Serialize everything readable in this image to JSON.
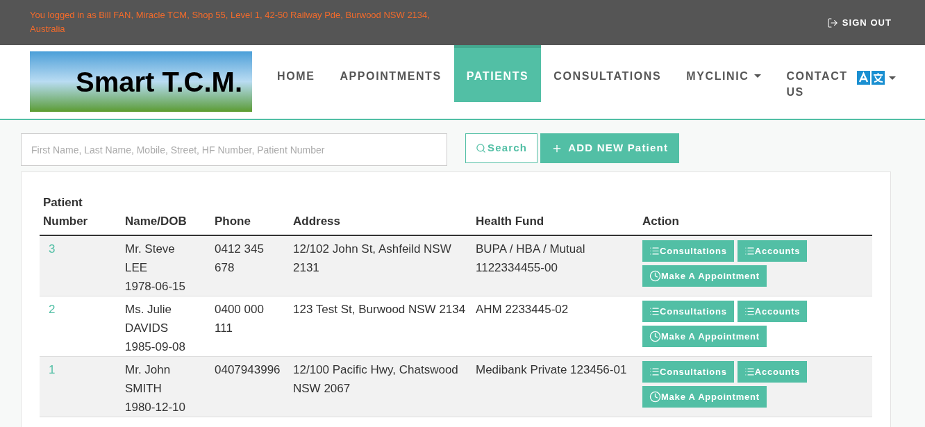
{
  "top_bar": {
    "login_text": "You logged in as Bill FAN, Miracle TCM, Shop 55, Level 1, 42-50 Railway Pde, Burwood NSW 2134, Australia",
    "sign_out": "SIGN OUT"
  },
  "logo": {
    "text": "Smart T.C.M."
  },
  "nav": [
    {
      "label": "HOME",
      "selected": false,
      "dropdown": false
    },
    {
      "label": "APPOINTMENTS",
      "selected": false,
      "dropdown": false
    },
    {
      "label": "PATIENTS",
      "selected": true,
      "dropdown": false
    },
    {
      "label": "CONSULTATIONS",
      "selected": false,
      "dropdown": false
    },
    {
      "label": "MYCLINIC",
      "selected": false,
      "dropdown": true
    },
    {
      "label": "CONTACT US",
      "selected": false,
      "dropdown": false
    }
  ],
  "search": {
    "placeholder": "First Name, Last Name, Mobile, Street, HF Number, Patient Number",
    "search_button": "Search",
    "add_button": "ADD NEW Patient"
  },
  "table": {
    "columns": [
      "Patient Number",
      "Name/DOB",
      "Phone",
      "Address",
      "Health Fund",
      "Action"
    ],
    "rows": [
      {
        "number": "3",
        "name": "Mr. Steve LEE",
        "dob": "1978-06-15",
        "phone": "0412 345 678",
        "address": "12/102 John St, Ashfeild NSW 2131",
        "health_fund": "BUPA / HBA / Mutual 1122334455-00",
        "actions": [
          "Consultations",
          "Accounts",
          "Make A Appointment"
        ]
      },
      {
        "number": "2",
        "name": "Ms. Julie DAVIDS",
        "dob": "1985-09-08",
        "phone": "0400 000 111",
        "address": "123 Test St, Burwood NSW 2134",
        "health_fund": "AHM 2233445-02",
        "actions": [
          "Consultations",
          "Accounts",
          "Make A Appointment"
        ]
      },
      {
        "number": "1",
        "name": "Mr. John SMITH",
        "dob": "1980-12-10",
        "phone": "0407943996",
        "address": "12/100 Pacific Hwy, Chatswood NSW 2067",
        "health_fund": "Medibank Private 123456-01",
        "actions": [
          "Consultations",
          "Accounts",
          "Make A Appointment"
        ]
      }
    ]
  }
}
